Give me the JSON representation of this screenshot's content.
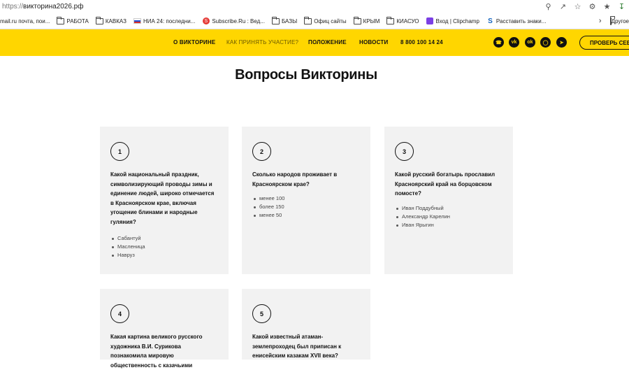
{
  "browser": {
    "url_scheme": "https://",
    "url_host": "викторина2026.рф",
    "icons": [
      "search-icon",
      "share-icon",
      "star-icon",
      "extension-icon",
      "favorites-icon",
      "download-icon"
    ],
    "bookmarks": [
      {
        "label": "mail.ru почта, пои...",
        "icon": "none"
      },
      {
        "label": "РАБОТА",
        "icon": "folder-icon"
      },
      {
        "label": "КАВКАЗ",
        "icon": "folder-icon"
      },
      {
        "label": "НИА 24: последни...",
        "icon": "flag-icon"
      },
      {
        "label": "Subscribe.Ru : Вед...",
        "icon": "subscribe-icon"
      },
      {
        "label": "БАЗЫ",
        "icon": "folder-icon"
      },
      {
        "label": "Офиц сайты",
        "icon": "folder-icon"
      },
      {
        "label": "КРЫМ",
        "icon": "folder-icon"
      },
      {
        "label": "КИАСУО",
        "icon": "folder-icon"
      },
      {
        "label": "Вход | Clipchamp",
        "icon": "clipchamp-icon"
      },
      {
        "label": "Расставить знаки...",
        "icon": "s-icon"
      }
    ],
    "other_bookmarks": "Другое"
  },
  "header": {
    "nav": [
      "О ВИКТОРИНЕ",
      "КАК ПРИНЯТЬ УЧАСТИЕ?",
      "ПОЛОЖЕНИЕ",
      "НОВОСТИ",
      "8 800 100 14 24"
    ],
    "social_icons": [
      "phone-icon",
      "vk-icon",
      "ok-icon",
      "max-icon",
      "telegram-icon"
    ],
    "check_button": "ПРОВЕРЬ СЕБЯ"
  },
  "page_title": "Вопросы Викторины",
  "questions": [
    {
      "number": "1",
      "text": "Какой национальный праздник, символизирующий проводы зимы и единение людей, широко отмечается в Красноярском крае, включая угощение блинами и народные гуляния?",
      "options": [
        "Сабантуй",
        "Масленица",
        "Навруз"
      ]
    },
    {
      "number": "2",
      "text": "Сколько народов проживает в Красноярском крае?",
      "options": [
        "менее 100",
        "более 150",
        "менее 50"
      ]
    },
    {
      "number": "3",
      "text": "Какой русский богатырь прославил Красноярский край на борцовском помосте?",
      "options": [
        "Иван Поддубный",
        "Александр Карелин",
        "Иван Ярыгин"
      ]
    },
    {
      "number": "4",
      "text": "Какая картина великого русского художника В.И. Сурикова познакомила мировую общественность с казачьими",
      "options": []
    },
    {
      "number": "5",
      "text": "Какой известный атаман-землепроходец был приписан к енисейским казакам XVII века?",
      "options": []
    }
  ]
}
